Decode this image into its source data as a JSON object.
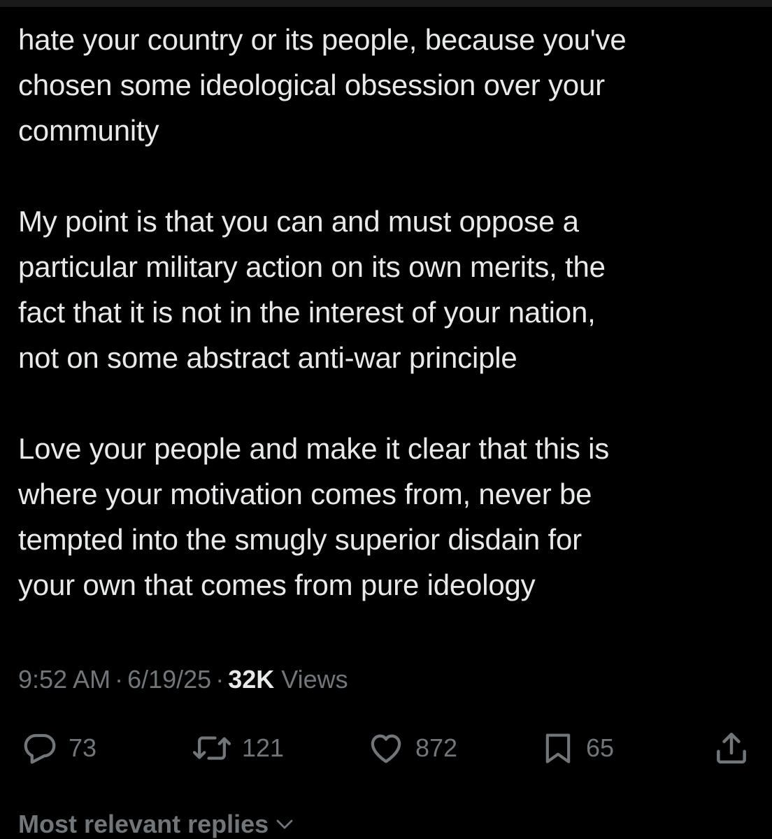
{
  "tweet": {
    "paragraphs": [
      "hate your country or its people, because you've\nchosen some ideological obsession over your\ncommunity",
      "My point is that you can and must oppose a\nparticular military action on its own merits, the\nfact that it is not in the interest of your nation,\nnot on some abstract anti-war principle",
      "Love your people and make it clear that this is\nwhere your motivation comes from, never be\ntempted into the smugly superior disdain for\nyour own that comes from pure ideology"
    ],
    "time": "9:52 AM",
    "date": "6/19/25",
    "separator": "·",
    "views_count": "32K",
    "views_label": "Views"
  },
  "actions": {
    "reply": {
      "icon": "reply-icon",
      "count": "73"
    },
    "repost": {
      "icon": "repost-icon",
      "count": "121"
    },
    "like": {
      "icon": "heart-icon",
      "count": "872"
    },
    "bookmark": {
      "icon": "bookmark-icon",
      "count": "65"
    },
    "share": {
      "icon": "share-icon"
    }
  },
  "replies": {
    "header": "Most relevant replies"
  },
  "colors": {
    "background": "#000000",
    "text": "#e7e9ea",
    "muted": "#71767b"
  }
}
